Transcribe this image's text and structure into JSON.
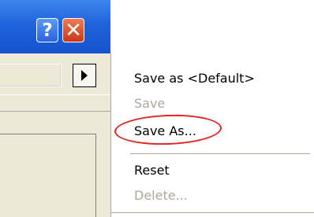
{
  "window": {
    "help_button_label": "?",
    "close_button_label": "✕",
    "titlebar_color": "#1f63dc"
  },
  "menu": {
    "items": [
      {
        "label": "Save as <Default>",
        "enabled": true
      },
      {
        "label": "Save",
        "enabled": false
      },
      {
        "label": "Save As...",
        "enabled": true,
        "highlighted": true
      },
      {
        "label": "Reset",
        "enabled": true
      },
      {
        "label": "Delete...",
        "enabled": false
      }
    ],
    "highlight_color": "#e5221f"
  },
  "icons": [
    "help-icon",
    "close-icon",
    "triangle-right-icon"
  ]
}
